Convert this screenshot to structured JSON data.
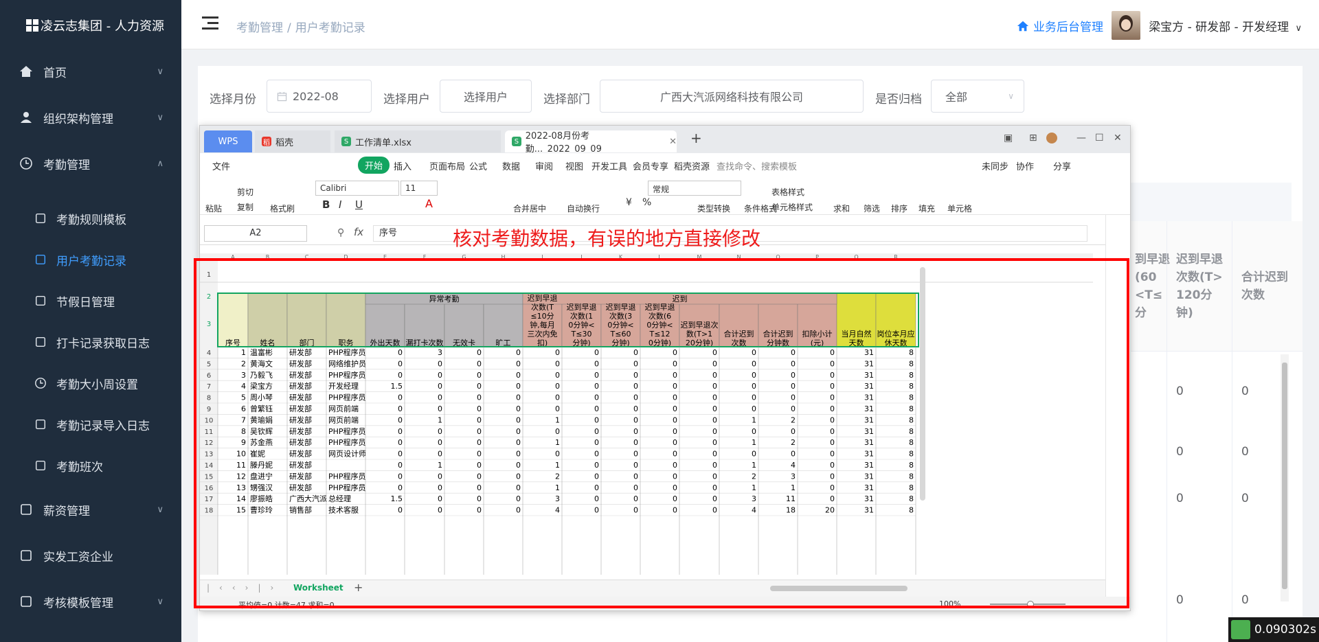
{
  "sidebar": {
    "logo": "凌云志集团 - 人力资源",
    "items": [
      {
        "label": "首页",
        "icon": "home-icon"
      },
      {
        "label": "组织架构管理",
        "icon": "user-icon"
      },
      {
        "label": "考勤管理",
        "icon": "clock-icon"
      },
      {
        "label": "考勤规则模板",
        "icon": "template-icon"
      },
      {
        "label": "用户考勤记录",
        "icon": "record-icon"
      },
      {
        "label": "节假日管理",
        "icon": "calendar-icon"
      },
      {
        "label": "打卡记录获取日志",
        "icon": "log-icon"
      },
      {
        "label": "考勤大小周设置",
        "icon": "clock-icon"
      },
      {
        "label": "考勤记录导入日志",
        "icon": "refresh-icon"
      },
      {
        "label": "考勤班次",
        "icon": "shift-icon"
      },
      {
        "label": "薪资管理",
        "icon": "money-icon"
      },
      {
        "label": "实发工资企业",
        "icon": "chart-icon"
      },
      {
        "label": "考核模板管理",
        "icon": "bar-icon"
      }
    ]
  },
  "header": {
    "breadcrumb": [
      "考勤管理",
      "用户考勤记录"
    ],
    "biz_link": "业务后台管理",
    "user": "梁宝方 - 研发部 - 开发经理"
  },
  "filters": {
    "month_label": "选择月份",
    "month_value": "2022-08",
    "user_label": "选择用户",
    "user_value": "选择用户",
    "dept_label": "选择部门",
    "dept_value": "广西大汽派网络科技有限公司",
    "archive_label": "是否归档",
    "archive_value": "全部"
  },
  "bg_table": {
    "headers": [
      "到早退\n(60\n<T≤\n分",
      "迟到早退\n次数(T>\n120分\n钟)",
      "合计迟到\n次数"
    ],
    "values": [
      "0",
      "0",
      "0",
      "0",
      "0",
      "0",
      "0",
      "0"
    ]
  },
  "wps": {
    "tabs": [
      "WPS",
      "稻壳",
      "工作清单.xlsx",
      "2022-08月份考勤..._2022_09_09"
    ],
    "menu": [
      "文件",
      "开始",
      "插入",
      "页面布局",
      "公式",
      "数据",
      "审阅",
      "视图",
      "开发工具",
      "会员专享",
      "稻壳资源",
      "查找命令、搜索模板",
      "未同步",
      "协作",
      "分享"
    ],
    "ribbon": {
      "font": "Calibri",
      "size": "11",
      "format": "常规",
      "labels": [
        "粘贴",
        "剪切",
        "复制",
        "格式刷",
        "合并居中",
        "自动换行",
        "类型转换",
        "条件格式",
        "表格样式",
        "单元格样式",
        "求和",
        "筛选",
        "排序",
        "填充",
        "单元格"
      ]
    },
    "cell_ref": "A2",
    "formula": "序号",
    "annotation": "核对考勤数据，有误的地方直接修改",
    "sheet_tab": "Worksheet",
    "status": "平均值=0  计数=47  求和=0",
    "zoom": "100%",
    "col_letters": [
      "A",
      "B",
      "C",
      "D",
      "E",
      "F",
      "G",
      "H",
      "I",
      "J",
      "K",
      "L",
      "M",
      "N",
      "O",
      "P",
      "Q",
      "R"
    ],
    "group_headers": [
      "异常考勤",
      "迟到"
    ],
    "headers": [
      "序号",
      "姓名",
      "部门",
      "职务",
      "外出天数",
      "漏打卡次数",
      "无效卡",
      "旷工",
      "迟到早退次数(T≤10分钟,每月三次内免扣)",
      "迟到早退次数(10分钟<T≤30分钟)",
      "迟到早退次数(30分钟<T≤60分钟)",
      "迟到早退次数(60分钟<T≤120分钟)",
      "迟到早退次数(T>120分钟)",
      "合计迟到次数",
      "合计迟到分钟数",
      "扣除小计(元)",
      "当月自然天数",
      "岗位本月应休天数"
    ],
    "rows": [
      [
        "1",
        "温富彬",
        "研发部",
        "PHP程序员",
        "0",
        "3",
        "0",
        "0",
        "0",
        "0",
        "0",
        "0",
        "0",
        "0",
        "0",
        "0",
        "31",
        "8"
      ],
      [
        "2",
        "黄海文",
        "研发部",
        "网络维护员",
        "0",
        "0",
        "0",
        "0",
        "0",
        "0",
        "0",
        "0",
        "0",
        "0",
        "0",
        "0",
        "31",
        "8"
      ],
      [
        "3",
        "乃毅飞",
        "研发部",
        "PHP程序员",
        "0",
        "0",
        "0",
        "0",
        "0",
        "0",
        "0",
        "0",
        "0",
        "0",
        "0",
        "0",
        "31",
        "8"
      ],
      [
        "4",
        "梁宝方",
        "研发部",
        "开发经理",
        "1.5",
        "0",
        "0",
        "0",
        "0",
        "0",
        "0",
        "0",
        "0",
        "0",
        "0",
        "0",
        "31",
        "8"
      ],
      [
        "5",
        "周小琴",
        "研发部",
        "PHP程序员",
        "0",
        "0",
        "0",
        "0",
        "0",
        "0",
        "0",
        "0",
        "0",
        "0",
        "0",
        "0",
        "31",
        "8"
      ],
      [
        "6",
        "曾繁钰",
        "研发部",
        "网页前端",
        "0",
        "0",
        "0",
        "0",
        "0",
        "0",
        "0",
        "0",
        "0",
        "0",
        "0",
        "0",
        "31",
        "8"
      ],
      [
        "7",
        "黄瑜娟",
        "研发部",
        "网页前端",
        "0",
        "1",
        "0",
        "0",
        "1",
        "0",
        "0",
        "0",
        "0",
        "1",
        "2",
        "0",
        "31",
        "8"
      ],
      [
        "8",
        "吴钦辉",
        "研发部",
        "PHP程序员",
        "0",
        "0",
        "0",
        "0",
        "0",
        "0",
        "0",
        "0",
        "0",
        "0",
        "0",
        "0",
        "31",
        "8"
      ],
      [
        "9",
        "苏金燕",
        "研发部",
        "PHP程序员",
        "0",
        "0",
        "0",
        "0",
        "1",
        "0",
        "0",
        "0",
        "0",
        "1",
        "2",
        "0",
        "31",
        "8"
      ],
      [
        "10",
        "崔妮",
        "研发部",
        "网页设计师",
        "0",
        "0",
        "0",
        "0",
        "0",
        "0",
        "0",
        "0",
        "0",
        "0",
        "0",
        "0",
        "31",
        "8"
      ],
      [
        "11",
        "滕丹妮",
        "研发部",
        "",
        "0",
        "1",
        "0",
        "0",
        "1",
        "0",
        "0",
        "0",
        "0",
        "1",
        "4",
        "0",
        "31",
        "8"
      ],
      [
        "12",
        "盘进宁",
        "研发部",
        "PHP程序员",
        "0",
        "0",
        "0",
        "0",
        "2",
        "0",
        "0",
        "0",
        "0",
        "2",
        "3",
        "0",
        "31",
        "8"
      ],
      [
        "13",
        "甥强汉",
        "研发部",
        "PHP程序员",
        "0",
        "0",
        "0",
        "0",
        "1",
        "0",
        "0",
        "0",
        "0",
        "1",
        "1",
        "0",
        "31",
        "8"
      ],
      [
        "14",
        "廖振皓",
        "广西大汽派",
        "总经理",
        "1.5",
        "0",
        "0",
        "0",
        "3",
        "0",
        "0",
        "0",
        "0",
        "3",
        "11",
        "0",
        "31",
        "8"
      ],
      [
        "15",
        "曹珍玲",
        "销售部",
        "技术客服",
        "0",
        "0",
        "0",
        "0",
        "4",
        "0",
        "0",
        "0",
        "0",
        "4",
        "18",
        "20",
        "31",
        "8"
      ]
    ],
    "row_numbers": [
      "1",
      "2",
      "3",
      "4",
      "5",
      "6",
      "7",
      "8",
      "9",
      "10",
      "11",
      "12",
      "13",
      "14",
      "15",
      "16",
      "17",
      "18"
    ]
  },
  "timer": "0.090302s",
  "colors": {
    "sidebar": "#1f2d3d",
    "accent": "#409eff",
    "wps_green": "#12a560",
    "red": "#ff0000"
  }
}
